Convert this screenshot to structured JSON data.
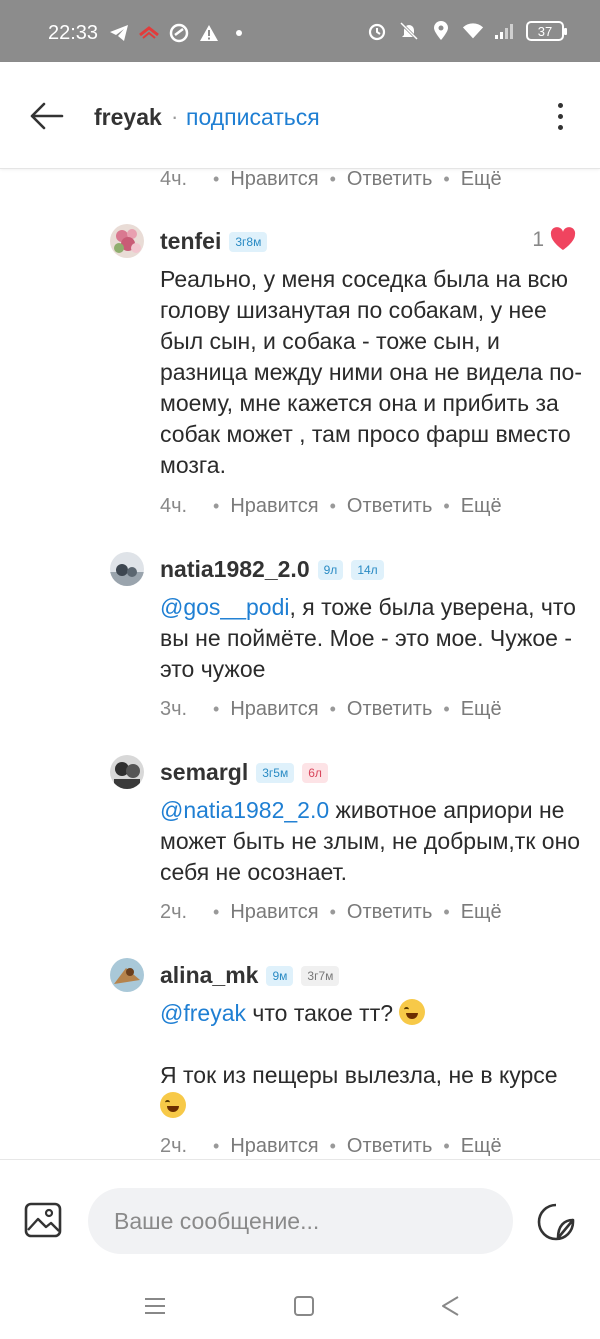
{
  "status_bar": {
    "time": "22:33",
    "battery": "37"
  },
  "header": {
    "title": "freyak",
    "separator": "·",
    "subscribe_label": "подписаться"
  },
  "actions": {
    "like": "Нравится",
    "reply": "Ответить",
    "more": "Ещё",
    "separator": "•"
  },
  "top_row": {
    "time": "4ч."
  },
  "comments": [
    {
      "username": "tenfei",
      "badges": [
        {
          "text": "3г8м",
          "kind": "blue"
        }
      ],
      "likes": "1",
      "text": "Реально, у меня соседка была на всю голову шизанутая по собакам, у нее был сын, и собака - тоже сын, и разница между ними она не видела по-моему, мне кажется она и прибить за собак может , там просо фарш вместо мозга.",
      "time": "4ч."
    },
    {
      "username": "natia1982_2.0",
      "badges": [
        {
          "text": "9л",
          "kind": "blue"
        },
        {
          "text": "14л",
          "kind": "blue"
        }
      ],
      "mention": "@gos__podi",
      "text": ", я тоже была уверена, что вы не поймёте. Мое - это мое. Чужое - это чужое",
      "time": "3ч."
    },
    {
      "username": "semargl",
      "badges": [
        {
          "text": "3г5м",
          "kind": "blue"
        },
        {
          "text": "6л",
          "kind": "pink"
        }
      ],
      "mention": "@natia1982_2.0",
      "text": " животное априори не может быть не злым, не добрым,тк оно себя не осознает.",
      "time": "2ч."
    },
    {
      "username": "alina_mk",
      "badges": [
        {
          "text": "9м",
          "kind": "blue"
        },
        {
          "text": "3г7м",
          "kind": "gray"
        }
      ],
      "mention": "@freyak",
      "text_line1": " что такое тт?",
      "text_line2": "Я ток из пещеры вылезла, не в курсе",
      "time": "2ч."
    }
  ],
  "compose": {
    "placeholder": "Ваше сообщение..."
  },
  "colors": {
    "accent": "#1f7fd3",
    "heart": "#f0445f",
    "status_bar": "#8c8c8c"
  },
  "icons": {
    "back": "arrow-left-icon",
    "more": "vertical-dots-icon",
    "image": "image-icon",
    "sticker": "sticker-icon",
    "heart": "heart-icon"
  }
}
